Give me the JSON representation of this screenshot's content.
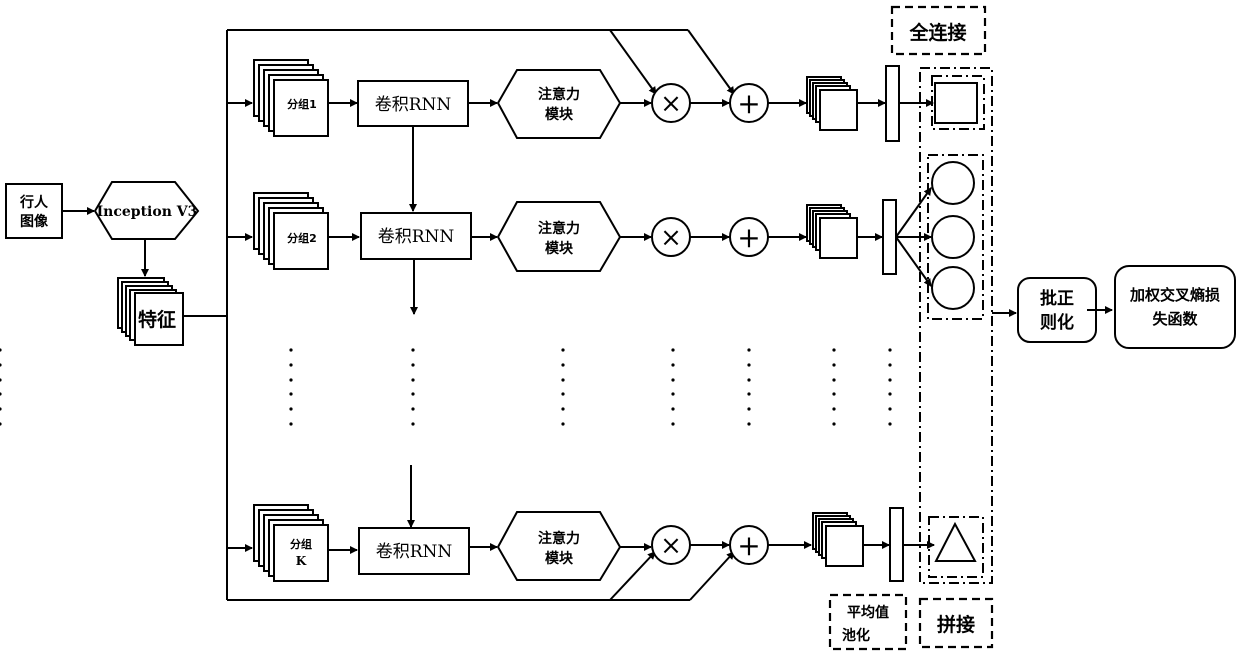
{
  "diagram": {
    "input": {
      "label_line1": "行人",
      "label_line2": "图像"
    },
    "backbone": {
      "label": "Inception V3"
    },
    "features": {
      "label": "特征"
    },
    "branches": [
      {
        "group_line1": "分组1",
        "group_line2": "",
        "conv_rnn": "卷积RNN",
        "attention_line1": "注意力",
        "attention_line2": "模块",
        "multiply": "×",
        "add": "+"
      },
      {
        "group_line1": "分组2",
        "group_line2": "",
        "conv_rnn": "卷积RNN",
        "attention_line1": "注意力",
        "attention_line2": "模块",
        "multiply": "×",
        "add": "+"
      },
      {
        "group_line1": "分组",
        "group_line2": "K",
        "conv_rnn": "卷积RNN",
        "attention_line1": "注意力",
        "attention_line2": "模块",
        "multiply": "×",
        "add": "+"
      }
    ],
    "fully_connected": {
      "label": "全连接"
    },
    "avg_pooling": {
      "label_line1": "平均值",
      "label_line2": "池化"
    },
    "concat": {
      "label": "拼接"
    },
    "batch_norm": {
      "label_line1": "批正",
      "label_line2": "则化"
    },
    "loss": {
      "label_line1": "加权交叉熵损",
      "label_line2": "失函数"
    },
    "fc_shapes": [
      "square",
      "circles",
      "triangle"
    ]
  }
}
